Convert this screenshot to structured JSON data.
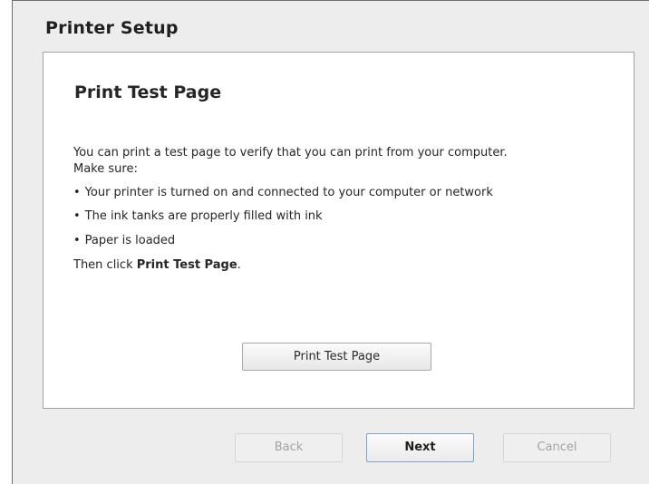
{
  "dialog": {
    "title": "Printer Setup"
  },
  "panel": {
    "heading": "Print Test Page",
    "intro_line1": "You can print a test page to verify that you can print from your computer.",
    "intro_line2": "Make sure:",
    "bullets": [
      "Your printer is turned on and connected to your computer or network",
      "The ink tanks are properly filled with ink",
      "Paper is loaded"
    ],
    "then_prefix": "Then click ",
    "then_bold": "Print Test Page",
    "then_suffix": ".",
    "print_button_label": "Print Test Page"
  },
  "footer": {
    "back_label": "Back",
    "next_label": "Next",
    "cancel_label": "Cancel"
  },
  "colors": {
    "window_bg": "#ededed",
    "panel_bg": "#ffffff",
    "default_button_border": "#7ea3c8",
    "disabled_text": "#a3a3a3"
  },
  "icons": {
    "bullet": "•"
  }
}
